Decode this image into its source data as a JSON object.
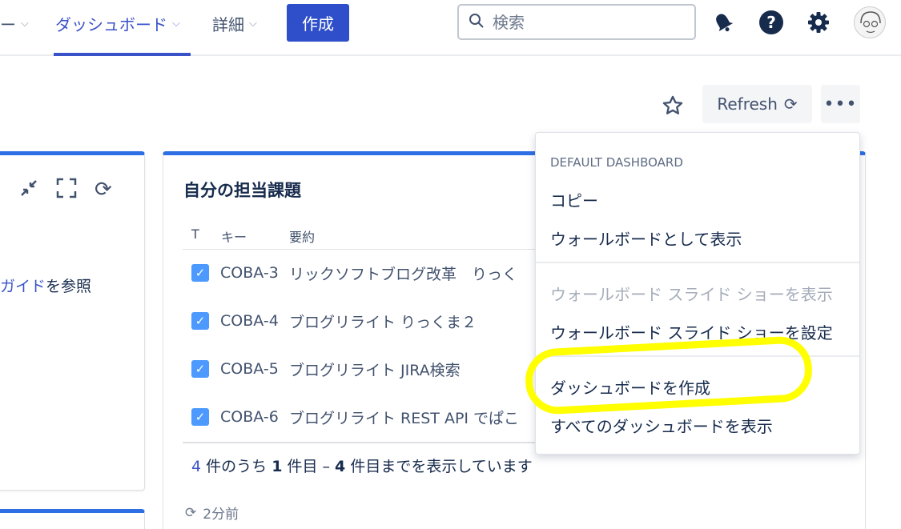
{
  "nav": {
    "partial_item": "ー",
    "dashboard": "ダッシュボード",
    "details": "詳細",
    "create": "作成",
    "search_placeholder": "検索"
  },
  "toolbar": {
    "refresh": "Refresh",
    "more": "•••"
  },
  "left_gadget": {
    "text_link": "ガイド",
    "text_rest": "を参照"
  },
  "gadget": {
    "title": "自分の担当課題",
    "columns": [
      "T",
      "キー",
      "要約"
    ],
    "rows": [
      {
        "key": "COBA-3",
        "summary": "リックソフトブログ改革　りっく"
      },
      {
        "key": "COBA-4",
        "summary": "ブログリライト りっくま２"
      },
      {
        "key": "COBA-5",
        "summary": "ブログリライト JIRA検索"
      },
      {
        "key": "COBA-6",
        "summary": "ブログリライト REST API でぱこ"
      }
    ],
    "footer": {
      "total": "4",
      "part1": " 件のうち ",
      "from": "1",
      "part2": " 件目 – ",
      "to": "4",
      "part3": " 件目までを表示しています"
    },
    "updated": "2分前"
  },
  "dropdown": {
    "heading": "DEFAULT DASHBOARD",
    "copy": "コピー",
    "view_wallboard": "ウォールボードとして表示",
    "slideshow_view": "ウォールボード スライド ショーを表示",
    "slideshow_settings": "ウォールボード スライド ショーを設定",
    "create_dashboard": "ダッシュボードを作成",
    "view_all": "すべてのダッシュボードを表示"
  },
  "colors": {
    "brand": "#2e4fc9",
    "gadget_border": "#2e6fe5",
    "highlight": "#ffff00",
    "checkbox": "#4c9aff"
  }
}
